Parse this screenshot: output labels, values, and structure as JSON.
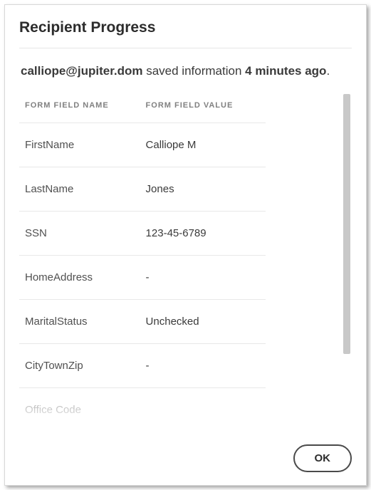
{
  "title": "Recipient Progress",
  "status": {
    "email": "calliope@jupiter.dom",
    "middle": " saved information ",
    "time": "4 minutes ago",
    "suffix": "."
  },
  "table": {
    "headers": {
      "name": "Form Field Name",
      "value": "Form Field Value"
    },
    "rows": [
      {
        "name": "FirstName",
        "value": "Calliope M"
      },
      {
        "name": "LastName",
        "value": "Jones"
      },
      {
        "name": "SSN",
        "value": "123-45-6789"
      },
      {
        "name": "HomeAddress",
        "value": "-"
      },
      {
        "name": "MaritalStatus",
        "value": "Unchecked"
      },
      {
        "name": "CityTownZip",
        "value": "-"
      },
      {
        "name": "Office Code",
        "value": ""
      }
    ]
  },
  "buttons": {
    "ok": "OK"
  }
}
